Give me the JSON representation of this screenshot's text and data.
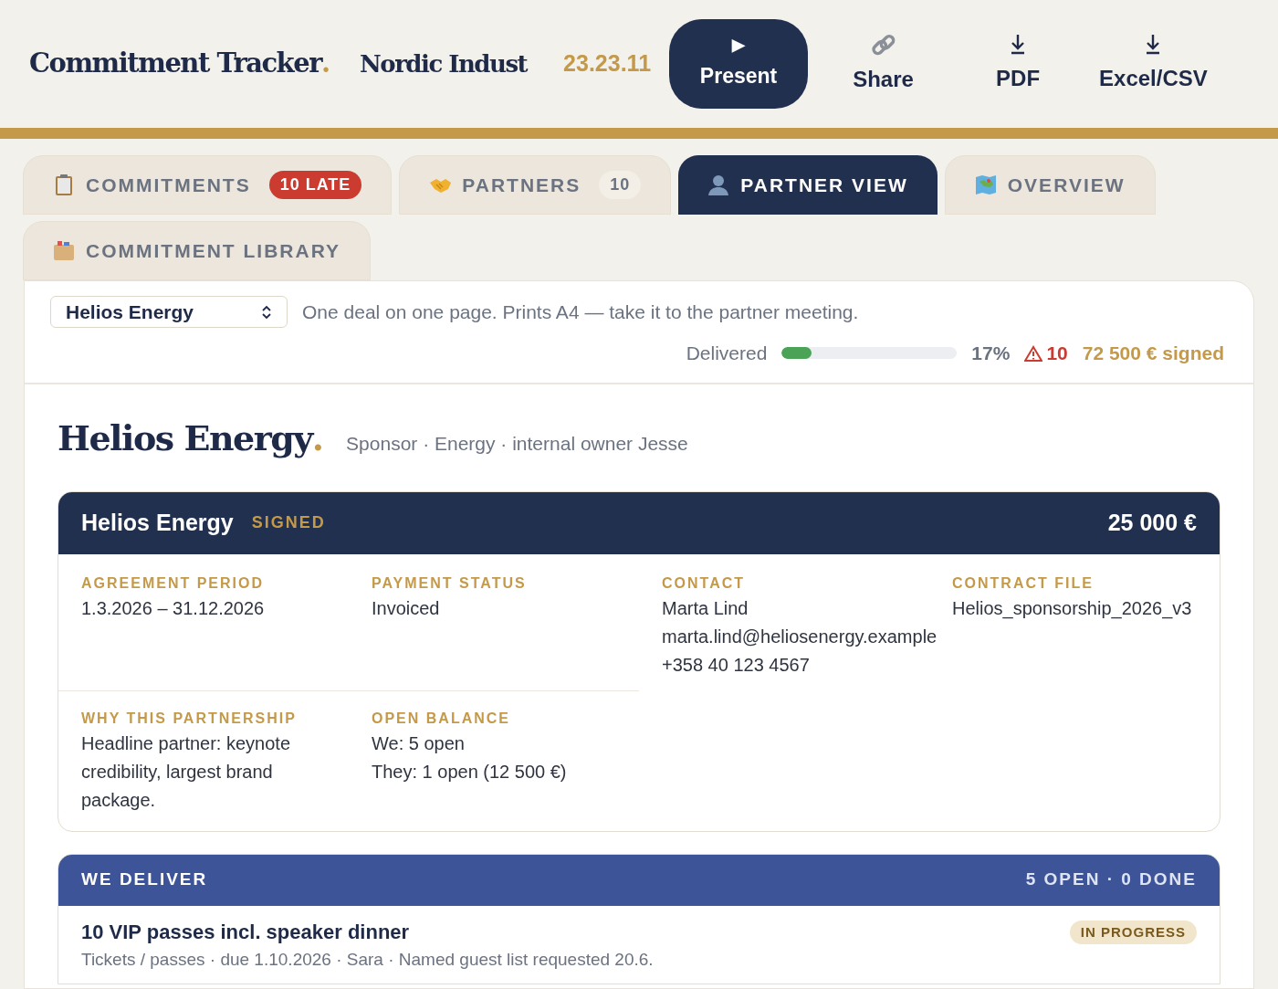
{
  "header": {
    "title": "Commitment Tracker",
    "title_accent": ".",
    "event": "Nordic Indust",
    "version": "23.23.11",
    "actions": [
      {
        "label": "Present",
        "kind": "primary",
        "glyph": "▶"
      },
      {
        "label": "Share",
        "kind": "link"
      },
      {
        "label": "PDF",
        "kind": "download"
      },
      {
        "label": "Excel/CSV",
        "kind": "download"
      }
    ]
  },
  "tabs": [
    {
      "label": "COMMITMENTS",
      "badge": {
        "text": "10 LATE",
        "kind": "alert"
      },
      "selected": false
    },
    {
      "label": "PARTNERS",
      "badge": {
        "text": "10",
        "kind": "count"
      },
      "selected": false
    },
    {
      "label": "PARTNER VIEW",
      "selected": true
    },
    {
      "label": "OVERVIEW",
      "selected": false
    },
    {
      "label": "COMMITMENT LIBRARY",
      "selected": false
    }
  ],
  "toolbar": {
    "partner_select": "Helios Energy",
    "hint": "One deal on one page. Prints A4 — take it to the partner meeting.",
    "delivered_label": "Delivered",
    "level": 0.17,
    "percent": "17%",
    "late": "10",
    "signed": "72 500 € signed"
  },
  "partner": {
    "name": "Helios Energy",
    "name_accent": ".",
    "meta": "Sponsor · Energy · internal owner Jesse"
  },
  "deal": {
    "name": "Helios Energy",
    "status": "SIGNED",
    "amount": "25 000 €",
    "fields": [
      {
        "label": "AGREEMENT PERIOD",
        "lines": [
          "1.3.2026 – 31.12.2026"
        ]
      },
      {
        "label": "PAYMENT STATUS",
        "lines": [
          "Invoiced"
        ]
      },
      {
        "label": "CONTACT",
        "lines": [
          "Marta Lind",
          "marta.lind@heliosenergy.example",
          "+358 40 123 4567"
        ]
      },
      {
        "label": "CONTRACT FILE",
        "lines": [
          "Helios_sponsorship_2026_v3"
        ]
      },
      {
        "label": "WHY THIS PARTNERSHIP",
        "lines": [
          "Headline partner: keynote credibility, largest brand package."
        ]
      },
      {
        "label": "OPEN BALANCE",
        "lines": [
          "We: 5 open",
          "They: 1 open (12 500 €)"
        ]
      }
    ]
  },
  "we_deliver": {
    "title": "WE DELIVER",
    "summary": "5 OPEN · 0 DONE",
    "items": [
      {
        "title": "10 VIP passes incl. speaker dinner",
        "meta": "Tickets / passes · due 1.10.2026 · Sara · Named guest list requested 20.6.",
        "status": "IN PROGRESS"
      }
    ]
  }
}
